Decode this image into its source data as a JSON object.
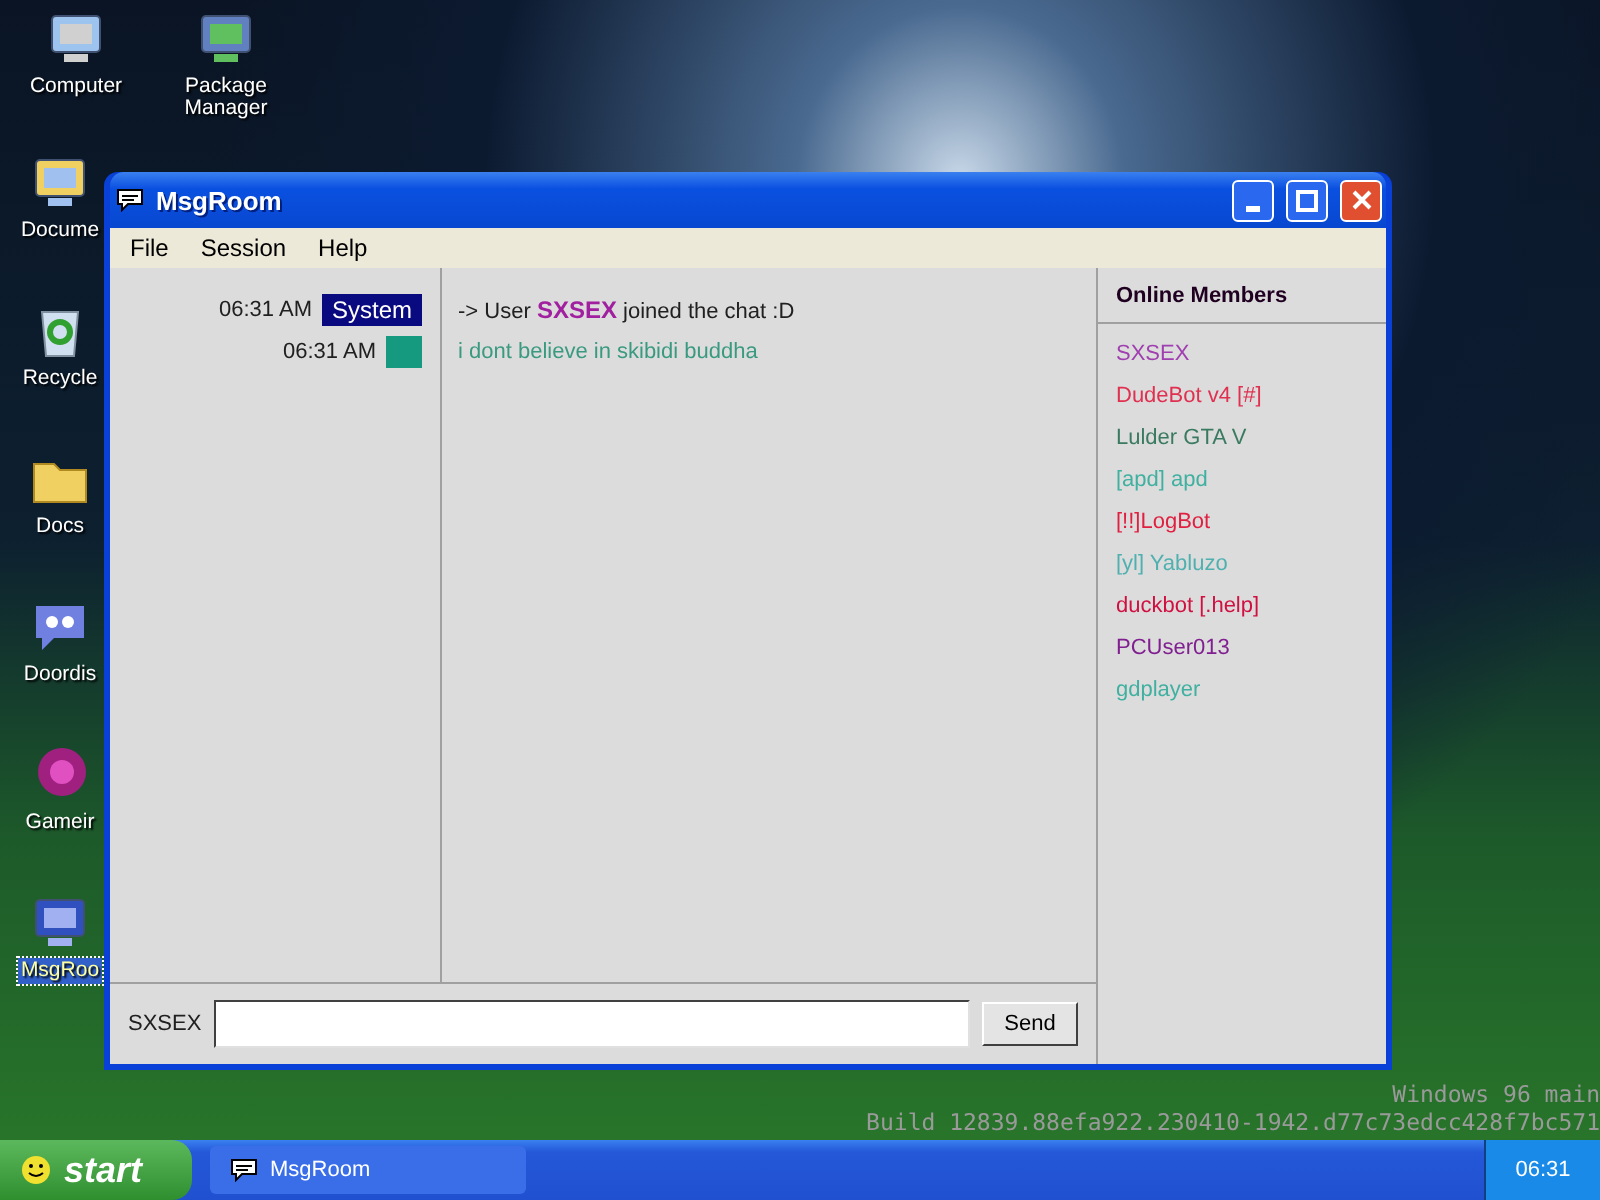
{
  "desktop": {
    "icons": [
      {
        "label": "Computer",
        "selected": false
      },
      {
        "label": "Package\nManager",
        "selected": false
      },
      {
        "label": "Docume",
        "selected": false
      },
      {
        "label": "Recycle",
        "selected": false
      },
      {
        "label": "Docs",
        "selected": false
      },
      {
        "label": "Doordis",
        "selected": false
      },
      {
        "label": "Gameir",
        "selected": false
      },
      {
        "label": "MsgRoo",
        "selected": true
      }
    ],
    "build_info": [
      "Windows 96 main",
      "Build 12839.88efa922.230410-1942.d77c73edcc428f7bc571"
    ]
  },
  "window": {
    "title": "MsgRoom",
    "menu": [
      "File",
      "Session",
      "Help"
    ],
    "messages": [
      {
        "time": "06:31 AM",
        "author": "System",
        "color": "#0a0a80",
        "parts": [
          {
            "text": "-> User ",
            "color": "#202020",
            "bold": false
          },
          {
            "text": "SXSEX",
            "color": "#a020a0",
            "bold": true
          },
          {
            "text": " joined the chat :D",
            "color": "#202020",
            "bold": false
          }
        ]
      },
      {
        "time": "06:31 AM",
        "color": "#159a80",
        "parts": [
          {
            "text": "i dont believe in skibidi buddha",
            "color": "#3a9a80",
            "bold": false
          }
        ]
      }
    ],
    "members_title": "Online Members",
    "members": [
      {
        "name": "SXSEX",
        "color": "#a040b0"
      },
      {
        "name": "DudeBot v4 [#]",
        "color": "#e03050"
      },
      {
        "name": "Lulder GTA V",
        "color": "#3a7a60"
      },
      {
        "name": "[apd] apd",
        "color": "#40b0a0"
      },
      {
        "name": "[!!]LogBot",
        "color": "#e02040"
      },
      {
        "name": "[yl] Yabluzo",
        "color": "#50b0b0"
      },
      {
        "name": "duckbot [.help]",
        "color": "#d01040"
      },
      {
        "name": "PCUser013",
        "color": "#802090"
      },
      {
        "name": "gdplayer",
        "color": "#40b0a0"
      }
    ],
    "input": {
      "nick": "SXSEX",
      "send": "Send"
    }
  },
  "taskbar": {
    "start": "start",
    "tasks": [
      {
        "label": "MsgRoom",
        "selected": false
      }
    ],
    "clock": "06:31"
  }
}
